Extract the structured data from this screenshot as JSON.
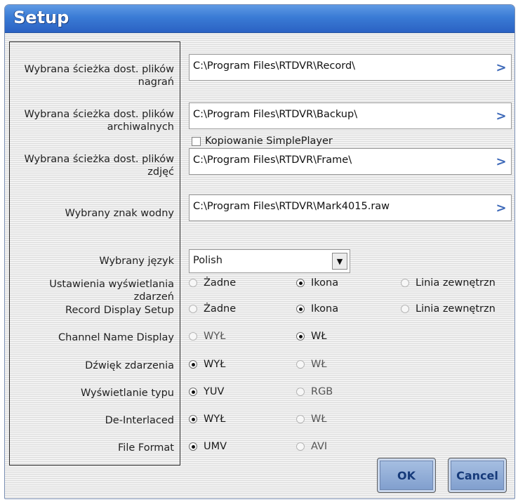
{
  "window": {
    "title": "Setup"
  },
  "paths": [
    {
      "label": "Wybrana ścieżka dost. plików nagrań",
      "value": "C:\\Program Files\\RTDVR\\Record\\",
      "browse": ">"
    },
    {
      "label": "Wybrana ścieżka dost. plików archiwalnych",
      "value": "C:\\Program Files\\RTDVR\\Backup\\",
      "browse": ">"
    },
    {
      "label": "Wybrana ścieżka dost. plików zdjęć",
      "value": "C:\\Program Files\\RTDVR\\Frame\\",
      "browse": ">"
    },
    {
      "label": "Wybrany znak wodny",
      "value": "C:\\Program Files\\RTDVR\\Mark4015.raw",
      "browse": ">"
    }
  ],
  "copy_simpleplayer": {
    "label": "Kopiowanie SimplePlayer",
    "checked": false
  },
  "language": {
    "label": "Wybrany język",
    "value": "Polish",
    "arrow": "▼"
  },
  "settings": [
    {
      "label": "Ustawienia wyświetlania zdarzeń",
      "options": [
        "Żadne",
        "Ikona",
        "Linia zewnętrzn"
      ],
      "selected": 1
    },
    {
      "label": "Record Display Setup",
      "options": [
        "Żadne",
        "Ikona",
        "Linia zewnętrzn"
      ],
      "selected": 1
    },
    {
      "label": "Channel Name Display",
      "options": [
        "WYŁ",
        "WŁ"
      ],
      "selected": 1
    },
    {
      "label": "Dźwięk zdarzenia",
      "options": [
        "WYŁ",
        "WŁ"
      ],
      "selected": 0
    },
    {
      "label": "Wyświetlanie typu",
      "options": [
        "YUV",
        "RGB"
      ],
      "selected": 0
    },
    {
      "label": "De-Interlaced",
      "options": [
        "WYŁ",
        "WŁ"
      ],
      "selected": 0
    },
    {
      "label": "File Format",
      "options": [
        "UMV",
        "AVI"
      ],
      "selected": 0
    }
  ],
  "buttons": {
    "ok": "OK",
    "cancel": "Cancel"
  }
}
